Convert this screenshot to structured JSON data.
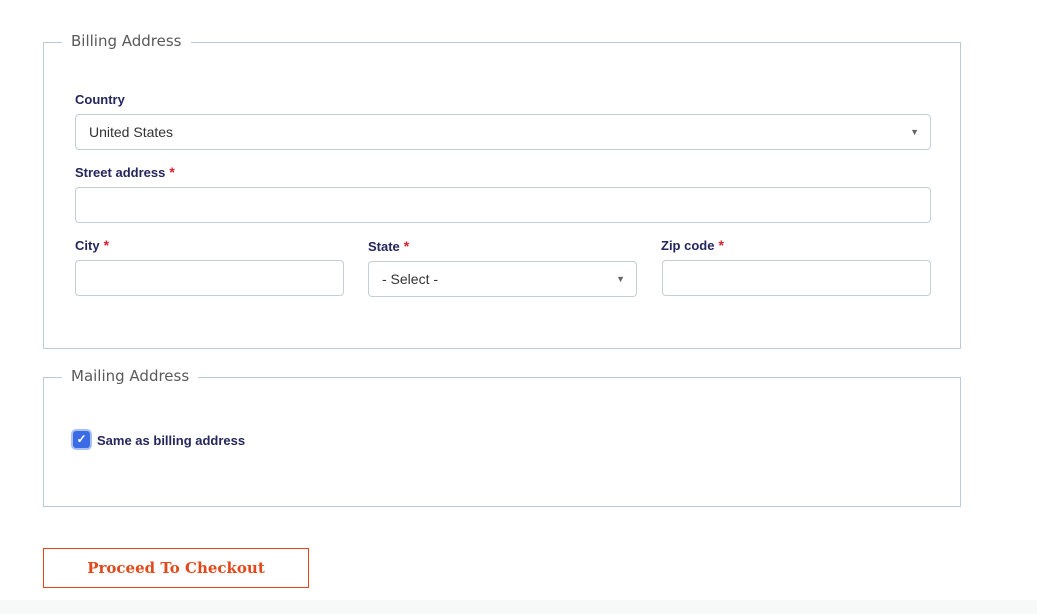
{
  "billing": {
    "legend": "Billing Address",
    "country": {
      "label": "Country",
      "value": "United States"
    },
    "street": {
      "label": "Street address",
      "required_mark": "*",
      "value": ""
    },
    "city": {
      "label": "City",
      "required_mark": "*",
      "value": ""
    },
    "state": {
      "label": "State",
      "required_mark": "*",
      "value": "- Select -"
    },
    "zip": {
      "label": "Zip code",
      "required_mark": "*",
      "value": ""
    }
  },
  "mailing": {
    "legend": "Mailing Address",
    "same_as_billing": {
      "label": "Same as billing address",
      "checked": true
    }
  },
  "checkout": {
    "label": "Proceed To Checkout"
  },
  "colors": {
    "label_text": "#24265d",
    "required": "#d81f2a",
    "checkbox": "#3b6ce6",
    "button_accent": "#e1491a",
    "fieldset_border": "#b8ccd6"
  },
  "icons": {
    "dropdown": "chevron-down-icon",
    "check": "check-icon"
  }
}
